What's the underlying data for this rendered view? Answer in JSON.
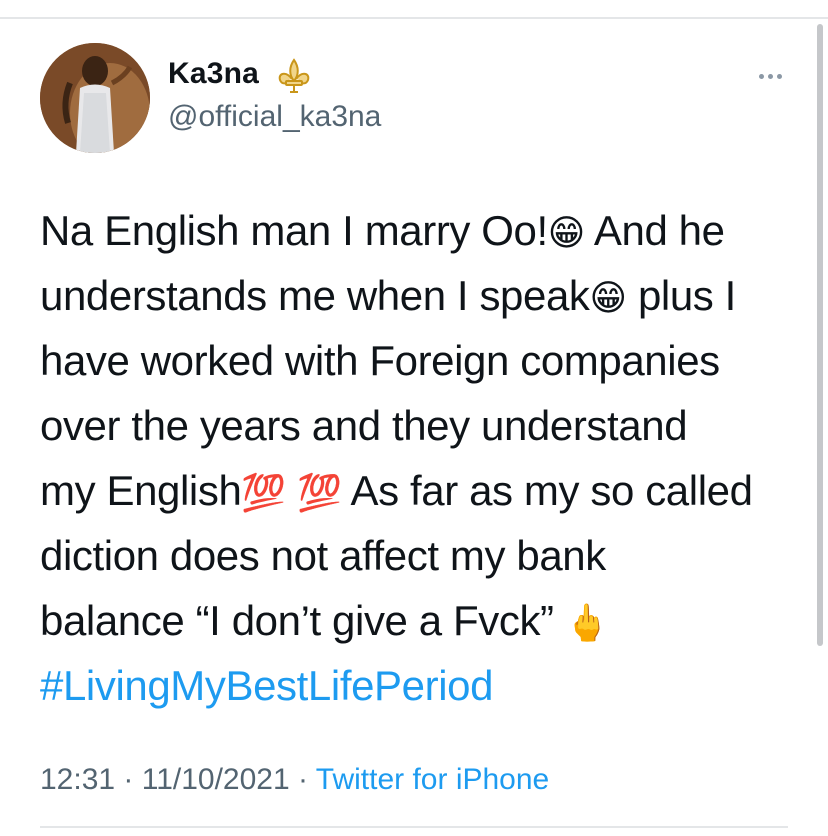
{
  "user": {
    "display_name": "Ka3na",
    "handle": "@official_ka3na",
    "badge_icon": "fleur-de-lis-icon",
    "badge_color": "#d4a017"
  },
  "tweet": {
    "lines": [
      [
        "Na English man I marry Oo!",
        "😁",
        " And he"
      ],
      [
        "understands me when I speak",
        "😁",
        " plus I"
      ],
      [
        "have worked with Foreign companies"
      ],
      [
        "over the years and they understand"
      ],
      [
        "my English",
        "💯",
        " ",
        "💯",
        " As far as my so called"
      ],
      [
        "diction does not affect my bank"
      ],
      [
        "balance “I don’t give a Fvck” ",
        "🖕"
      ]
    ],
    "hashtag": "#LivingMyBestLifePeriod"
  },
  "meta": {
    "time": "12:31",
    "sep1": " · ",
    "date": "11/10/2021",
    "sep2": " · ",
    "source": "Twitter for iPhone"
  },
  "colors": {
    "link": "#1d9bf0",
    "secondary": "#536471",
    "text": "#0f1419"
  },
  "icons": {
    "more": "more-horizontal-icon"
  }
}
